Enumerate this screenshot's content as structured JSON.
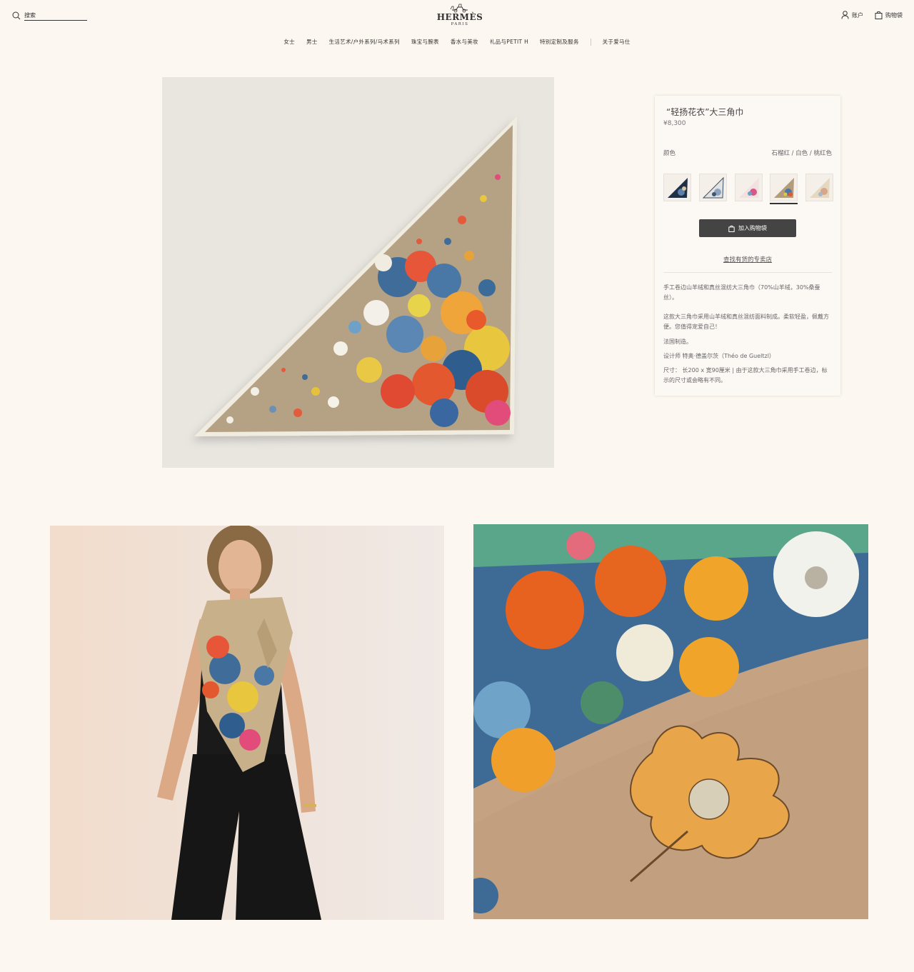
{
  "header": {
    "search_placeholder": "搜索",
    "logo_word": "HERMÈS",
    "logo_sub": "PARIS",
    "account_label": "账户",
    "cart_label": "购物袋"
  },
  "nav": {
    "items": [
      "女士",
      "男士",
      "生活艺术/户外系列/马术系列",
      "珠宝与腕表",
      "香水与美妆",
      "礼品与PETIT H",
      "特别定制及服务"
    ],
    "about": "关于爱马仕"
  },
  "product": {
    "title": "“轻扬花衣”大三角巾",
    "price": "¥8,300",
    "color_label": "颜色",
    "color_value": "石榴红 / 白色 / 桃红色",
    "swatches": [
      {
        "name": "navy",
        "fill": "#1f2f45"
      },
      {
        "name": "white",
        "fill": "#e8e8e4"
      },
      {
        "name": "pink",
        "fill": "#f1e2e0"
      },
      {
        "name": "beige",
        "fill": "#b29c7a",
        "selected": true
      },
      {
        "name": "light-beige",
        "fill": "#e6d7bf"
      }
    ],
    "add_to_cart": "加入购物袋",
    "find_store": "查找有货的专卖店",
    "desc_material": "手工卷边山羊绒和真丝混纺大三角巾（70%山羊绒，30%桑蚕丝）。",
    "desc_body": "这款大三角巾采用山羊绒和真丝混纺面料制成。柔软轻盈，佩戴方便。您值得宠爱自己！",
    "desc_origin": "法国制造。",
    "desc_designer": "设计师 特奥·德盖尔茨（Théo de Gueltzl）",
    "desc_size": "尺寸： 长200 x 宽90厘米 | 由于这款大三角巾采用手工卷边，标示的尺寸或会略有不同。"
  },
  "colors": {
    "background": "#fcf7f1",
    "button": "#444444",
    "scarf_base": "#b5a183"
  }
}
